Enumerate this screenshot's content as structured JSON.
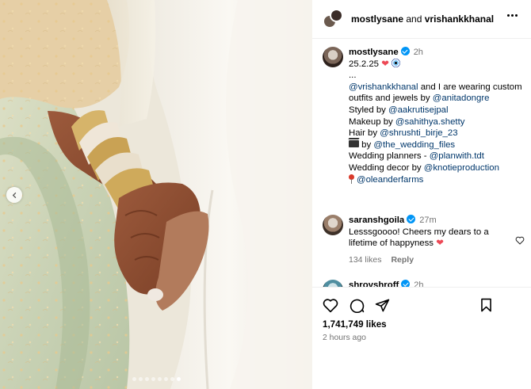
{
  "header": {
    "user1": "mostlysane",
    "joiner": "and",
    "user2": "vrishankkhanal"
  },
  "caption": {
    "username": "mostlysane",
    "time": "2h",
    "date_line": "25.2.25",
    "ellipsis": "...",
    "line1_mention": "@vrishankkhanal",
    "line1_rest": " and I are wearing custom outfits and jewels by ",
    "line1_mention2": "@anitadongre",
    "styled_label": "Styled by ",
    "styled_mention": "@aakrutisejpal",
    "makeup_label": "Makeup by ",
    "makeup_mention": "@sahithya.shetty",
    "hair_label": "Hair by ",
    "hair_mention": "@shrushti_birje_23",
    "photo_label": " by ",
    "photo_mention": "@the_wedding_files",
    "planners_label": "Wedding planners - ",
    "planners_mention": "@planwith.tdt",
    "decor_label": "Wedding decor by ",
    "decor_mention": "@knotieproduction",
    "venue_mention": "@oleanderfarms"
  },
  "comments": [
    {
      "username": "saranshgoila",
      "time": "27m",
      "text": "Lesssgoooo! Cheers my dears to a lifetime of happyness",
      "likes": "134 likes",
      "reply": "Reply"
    },
    {
      "username": "shroyshroff",
      "time": "2h"
    }
  ],
  "post": {
    "likes": "1,741,749 likes",
    "posted": "2 hours ago"
  },
  "carousel": {
    "dot_count": 8,
    "active_index": 7
  },
  "colors": {
    "accent": "#0095f6",
    "mention": "#00376b",
    "heart": "#ed4956",
    "muted": "#737373"
  },
  "icons": {
    "like": "heart-outline-icon",
    "comment": "speech-bubble-icon",
    "share": "paper-plane-icon",
    "save": "bookmark-icon",
    "more": "more-dots-icon",
    "prev": "chevron-left-icon"
  }
}
